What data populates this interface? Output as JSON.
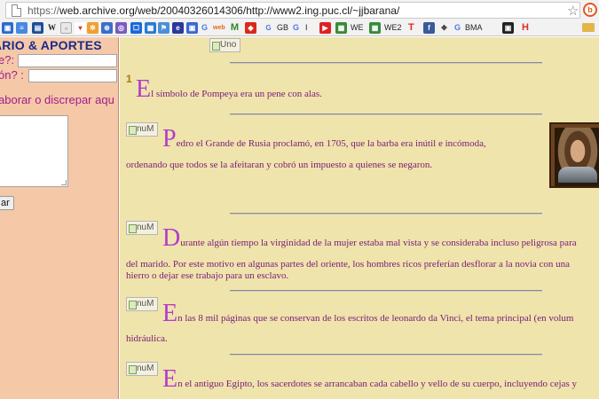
{
  "browser": {
    "url_protocol": "https://",
    "url_rest": "web.archive.org/web/20040326014306/http://www2.ing.puc.cl/~jjbarana/",
    "bookmarks": [
      "W",
      "G",
      "GB",
      "G",
      "I",
      "WE",
      "WE2",
      "T",
      "G",
      "BMA",
      "H"
    ]
  },
  "left_frame": {
    "title": "ARIO & APORTES",
    "q_name": "e?:",
    "q_email": "ón? :",
    "prompt": "aborar o discrepar aqu",
    "submit_label": "ar"
  },
  "main": {
    "header_image_alt": "Uno",
    "item_image_alt": "nuM",
    "facts": [
      {
        "cap": "E",
        "text": "l símbolo de Pompeya era un pene con alas."
      },
      {
        "cap": "P",
        "text": "edro el Grande de Rusia proclamó, en 1705, que la barba era inútil e incómoda,",
        "line2": "ordenando que todos se la afeitaran y cobró un impuesto a quienes se negaron."
      },
      {
        "cap": "D",
        "text": "urante algún tiempo la virginidad de la mujer estaba mal vista y se consideraba incluso peligrosa para",
        "line2": "del marido. Por este motivo en algunas partes del oriente, los hombres ricos preferían desflorar a la novia con una",
        "line3": "hierro o dejar ese trabajo para un esclavo."
      },
      {
        "cap": "E",
        "text": "n las 8 mil páginas que se conservan de los escritos de leonardo da Vinci, el tema principal (en volum",
        "line2": "hidráulica."
      },
      {
        "cap": "E",
        "text": "n el antiguo Egipto, los sacerdotes se arrancaban cada cabello y vello de su cuerpo, incluyendo cejas y"
      }
    ]
  }
}
